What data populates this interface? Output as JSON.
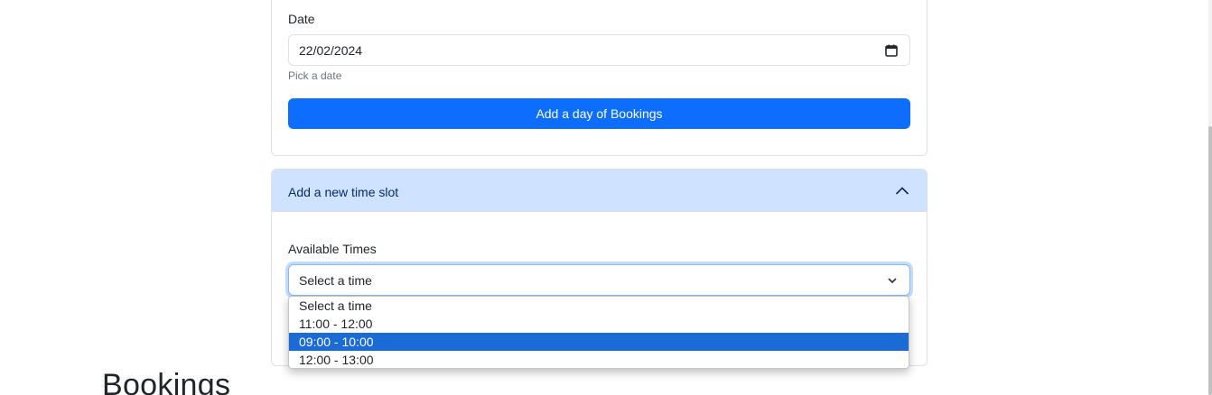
{
  "day_form": {
    "date_label": "Date",
    "date_value": "22/02/2024",
    "date_hint": "Pick a date",
    "submit_label": "Add a day of Bookings"
  },
  "time_slot_section": {
    "header_title": "Add a new time slot",
    "available_times_label": "Available Times",
    "select_value": "Select a time",
    "options": [
      "Select a time",
      "11:00 - 12:00",
      "09:00 - 10:00",
      "12:00 - 13:00"
    ],
    "highlighted_option": "09:00 - 10:00"
  },
  "bookings_heading": "Bookings",
  "icons": {
    "calendar": "calendar-icon",
    "accordion_toggle": "chevron-up-icon",
    "select_arrow": "chevron-down-icon"
  },
  "colors": {
    "primary": "#0d6efd",
    "accordion_header_bg": "#cfe2ff",
    "option_highlight": "#1a6bd6"
  }
}
